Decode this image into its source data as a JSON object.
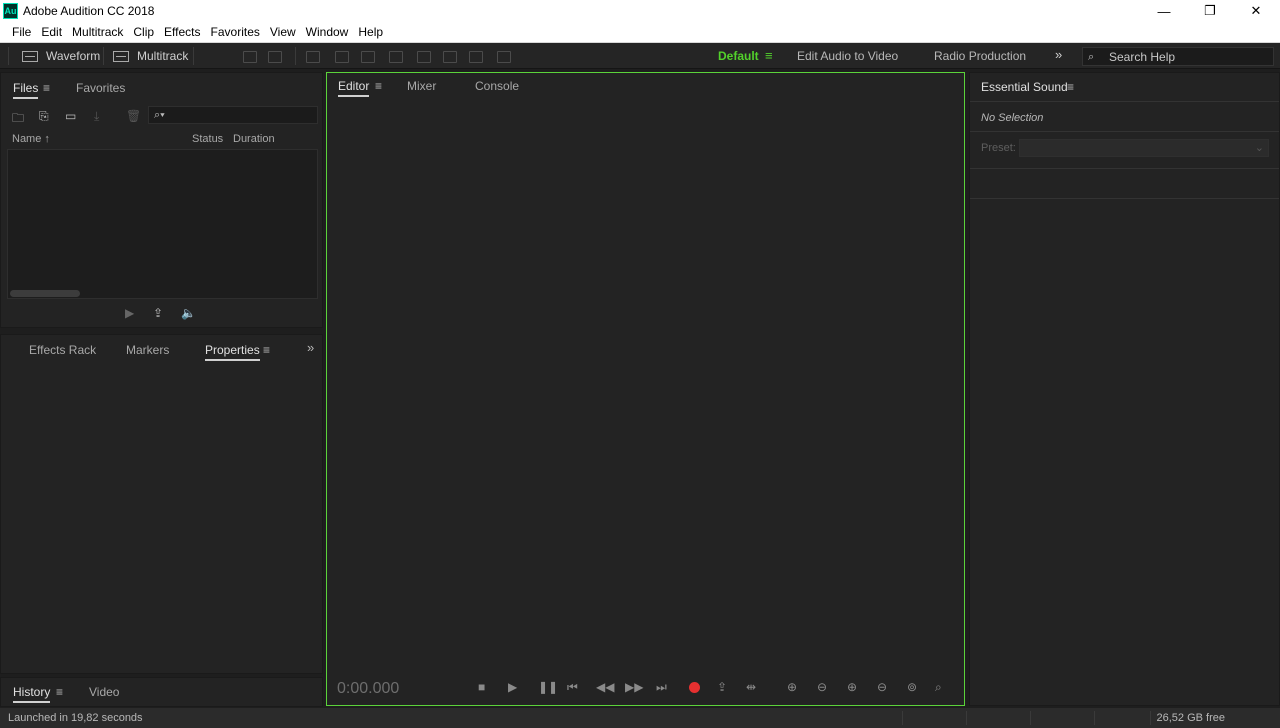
{
  "app": {
    "icon_text": "Au",
    "title": "Adobe Audition CC 2018"
  },
  "window_controls": {
    "minimize": "—",
    "maximize": "❐",
    "close": "✕"
  },
  "menu": [
    "File",
    "Edit",
    "Multitrack",
    "Clip",
    "Effects",
    "Favorites",
    "View",
    "Window",
    "Help"
  ],
  "toolbar": {
    "waveform_label": "Waveform",
    "multitrack_label": "Multitrack",
    "workspaces": {
      "active": "Default",
      "items": [
        "Edit Audio to Video",
        "Radio Production"
      ]
    },
    "search_placeholder": "Search Help"
  },
  "files_panel": {
    "tabs": [
      "Files",
      "Favorites"
    ],
    "columns": {
      "name": "Name ↑",
      "status": "Status",
      "duration": "Duration"
    }
  },
  "properties_panel": {
    "tabs": [
      "Effects Rack",
      "Markers",
      "Properties"
    ]
  },
  "history_panel": {
    "tabs": [
      "History",
      "Video"
    ]
  },
  "editor_panel": {
    "tabs": [
      "Editor",
      "Mixer",
      "Console"
    ],
    "timecode": "0:00.000"
  },
  "essential_sound": {
    "title": "Essential Sound",
    "no_selection": "No Selection",
    "preset_label": "Preset:"
  },
  "status": {
    "launch": "Launched in 19,82 seconds",
    "free_space": "26,52 GB free"
  },
  "colors": {
    "accent_green": "#52d12b",
    "record_red": "#e53030"
  }
}
